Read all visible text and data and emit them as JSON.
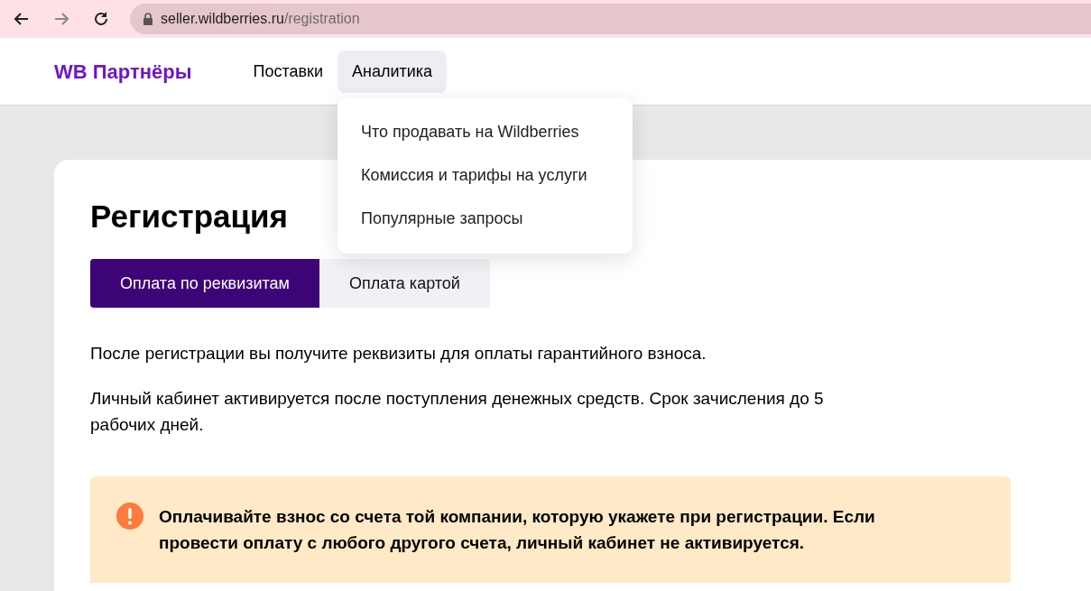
{
  "browser": {
    "url_host": "seller.wildberries.ru",
    "url_path": "/registration"
  },
  "header": {
    "logo": "WB Партнёры",
    "nav": [
      {
        "label": "Поставки",
        "expanded": false
      },
      {
        "label": "Аналитика",
        "expanded": true,
        "menu": [
          "Что продавать на Wildberries",
          "Комиссия и тарифы на услуги",
          "Популярные запросы"
        ]
      }
    ]
  },
  "page": {
    "title": "Регистрация",
    "tabs": [
      {
        "label": "Оплата по реквизитам",
        "selected": true
      },
      {
        "label": "Оплата картой",
        "selected": false
      }
    ],
    "paragraphs": [
      "После регистрации вы получите реквизиты для оплаты гарантийного взноса.",
      "Личный кабинет активируется после поступления денежных средств. Срок зачисления до 5 рабочих дней."
    ],
    "alert": {
      "text": "Оплачивайте взнос со счета той компании, которую укажете при регистрации. Если провести оплату с любого другого счета, личный кабинет не активируется."
    }
  }
}
